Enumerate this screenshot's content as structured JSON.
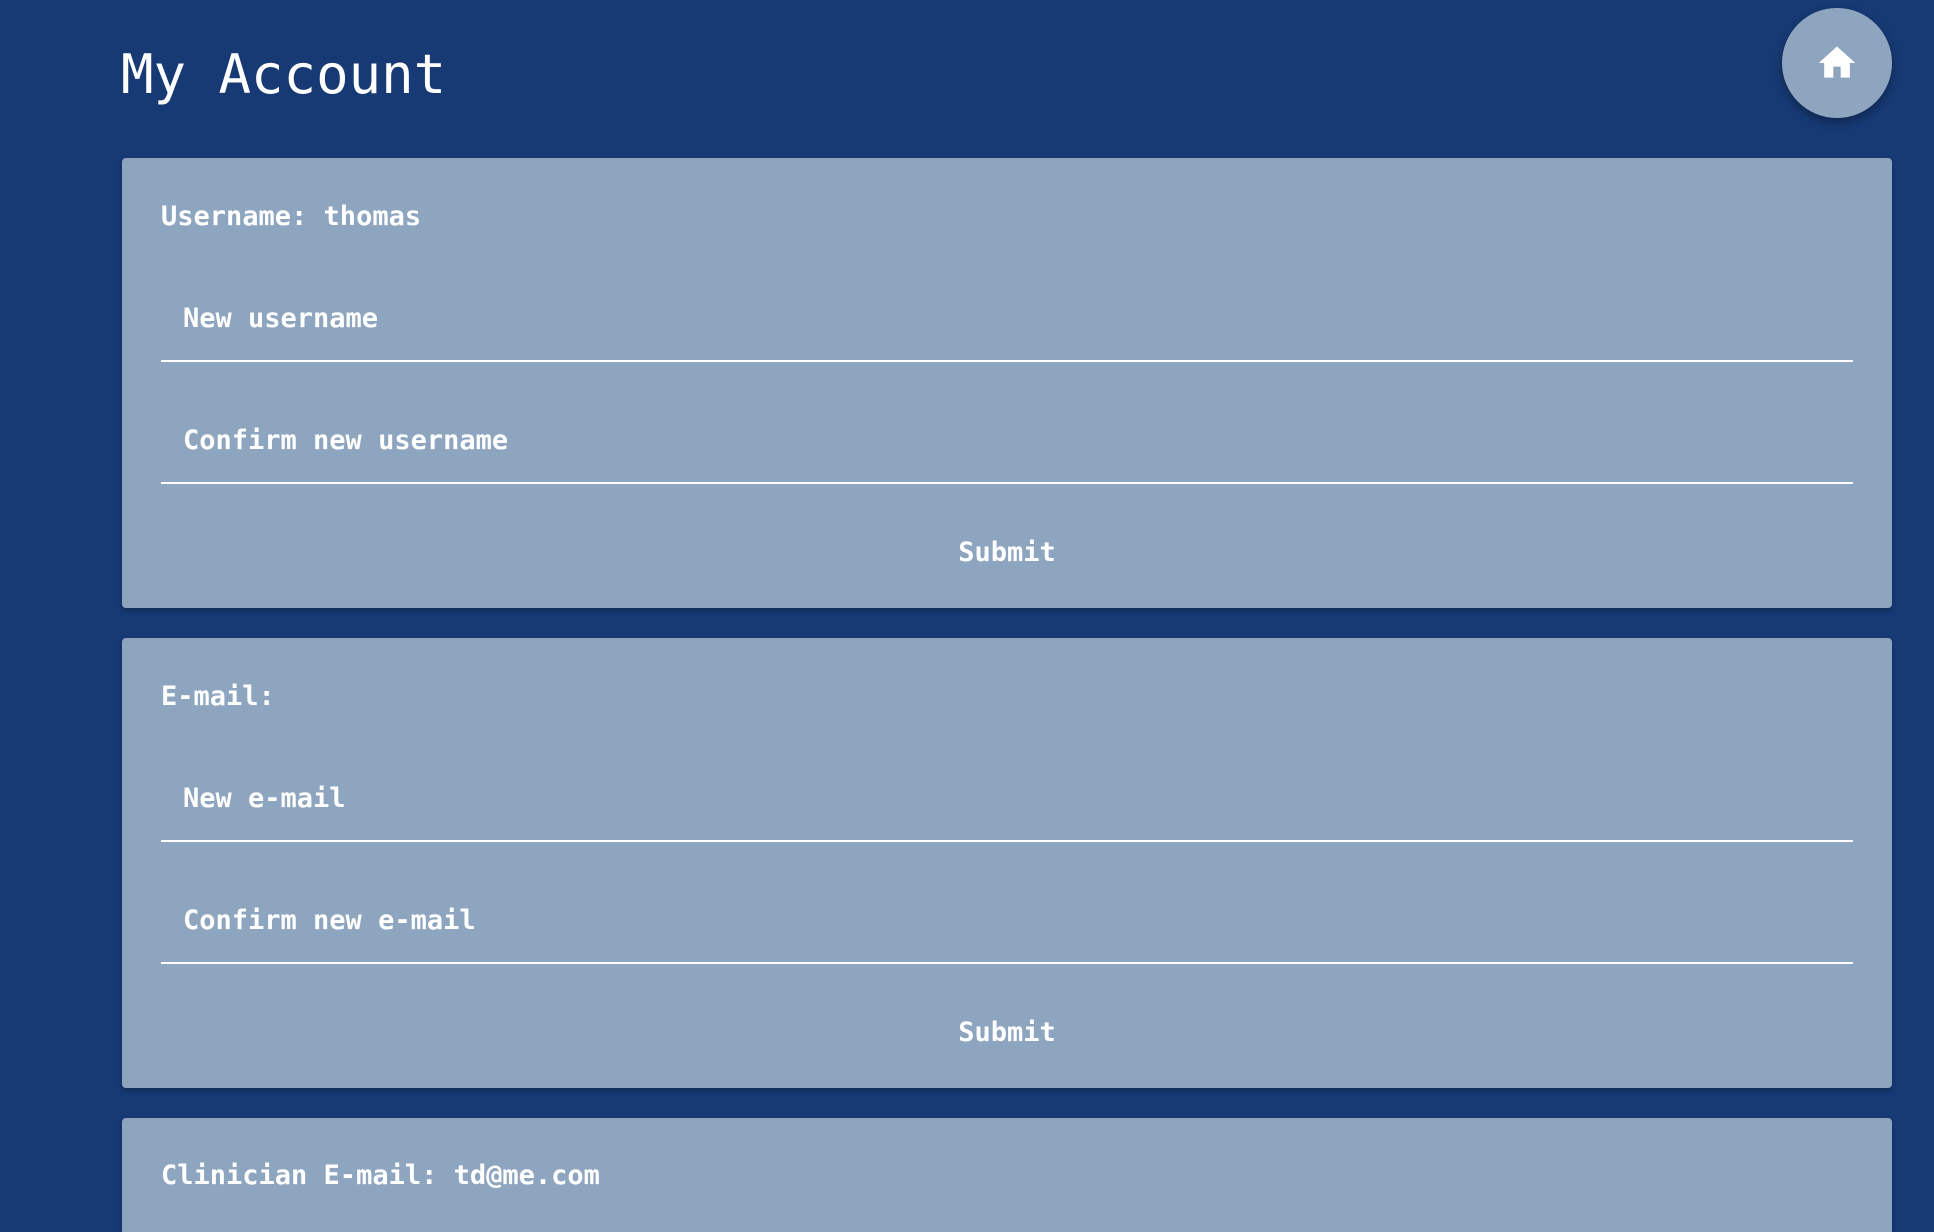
{
  "page": {
    "title": "My Account"
  },
  "home_button": {
    "icon": "home-icon"
  },
  "username_section": {
    "label": "Username: thomas",
    "new_username_placeholder": "New username",
    "new_username_value": "",
    "confirm_username_placeholder": "Confirm new username",
    "confirm_username_value": "",
    "submit_label": "Submit"
  },
  "email_section": {
    "label": "E-mail:",
    "new_email_placeholder": "New e-mail",
    "new_email_value": "",
    "confirm_email_placeholder": "Confirm new e-mail",
    "confirm_email_value": "",
    "submit_label": "Submit"
  },
  "clinician_section": {
    "label": "Clinician E-mail: td@me.com"
  },
  "colors": {
    "background": "#173a75",
    "card": "#8ea5bf",
    "text": "#ffffff"
  }
}
